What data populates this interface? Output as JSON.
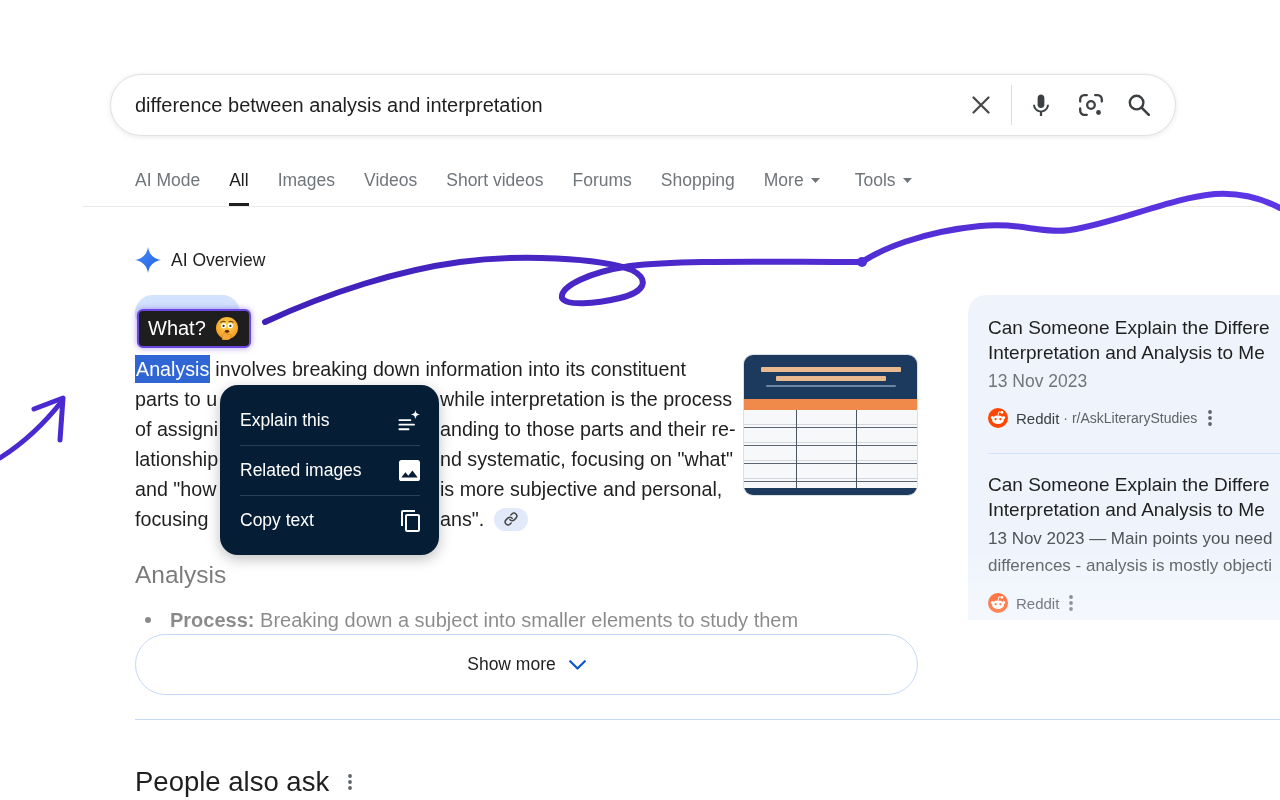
{
  "search": {
    "query": "difference between analysis and interpretation"
  },
  "tabs": [
    {
      "label": "AI Mode",
      "selected": false,
      "dropdown": false
    },
    {
      "label": "All",
      "selected": true,
      "dropdown": false
    },
    {
      "label": "Images",
      "selected": false,
      "dropdown": false
    },
    {
      "label": "Videos",
      "selected": false,
      "dropdown": false
    },
    {
      "label": "Short videos",
      "selected": false,
      "dropdown": false
    },
    {
      "label": "Forums",
      "selected": false,
      "dropdown": false
    },
    {
      "label": "Shopping",
      "selected": false,
      "dropdown": false
    },
    {
      "label": "More",
      "selected": false,
      "dropdown": true
    }
  ],
  "tools": {
    "label": "Tools",
    "dropdown": true
  },
  "ai_overview": {
    "title": "AI Overview",
    "reaction": {
      "label": "What?"
    },
    "text_lines": [
      {
        "kind": "whole",
        "segments": [
          {
            "text": "Analysis",
            "selected": true
          },
          {
            "text": "involves breaking down information into its constituent",
            "selected": false
          }
        ]
      },
      {
        "kind": "split",
        "before": "parts to u",
        "after": "while interpretation is the process"
      },
      {
        "kind": "split",
        "before": "of assigni",
        "after": "anding to those parts and their re-"
      },
      {
        "kind": "split",
        "before": "lationship",
        "after": "nd systematic, focusing on \"what\""
      },
      {
        "kind": "split",
        "before": "and \"how",
        "after": "is more subjective and personal,"
      },
      {
        "kind": "split",
        "before": "focusing",
        "after": "ans\"."
      }
    ],
    "source_link": true,
    "context_menu": [
      {
        "kind": "explain",
        "label": "Explain this"
      },
      {
        "kind": "images",
        "label": "Related images"
      },
      {
        "kind": "copy",
        "label": "Copy text"
      }
    ],
    "subheading": "Analysis",
    "bullets": [
      "**Process:** Breaking down a subject into smaller elements to study them"
    ],
    "show_more": "Show more"
  },
  "sources": [
    {
      "title_lines": [
        "Can Someone Explain the Differe",
        "Interpretation and Analysis to Me"
      ],
      "date": "13 Nov 2023",
      "site": "Reddit",
      "path": "· r/AskLiteraryStudies"
    },
    {
      "title_lines": [
        "Can Someone Explain the Differe",
        "Interpretation and Analysis to Me"
      ],
      "snippet_lines": [
        "13 Nov 2023 — Main points you need",
        "differences - analysis is mostly objecti"
      ],
      "site": "Reddit"
    }
  ],
  "people_also_ask": {
    "title": "People also ask"
  }
}
